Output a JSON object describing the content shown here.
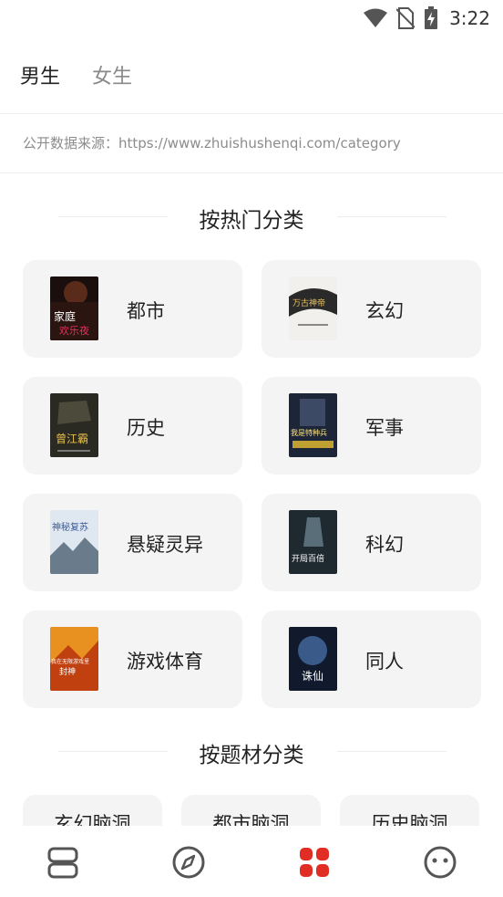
{
  "status_bar": {
    "time": "3:22"
  },
  "tabs": [
    {
      "label": "男生"
    },
    {
      "label": "女生"
    }
  ],
  "source_text": "公开数据来源：https://www.zhuishushenqi.com/category",
  "hot_section": {
    "title": "按热门分类",
    "categories": [
      {
        "label": "都市"
      },
      {
        "label": "玄幻"
      },
      {
        "label": "历史"
      },
      {
        "label": "军事"
      },
      {
        "label": "悬疑灵异"
      },
      {
        "label": "科幻"
      },
      {
        "label": "游戏体育"
      },
      {
        "label": "同人"
      }
    ]
  },
  "covers": [
    {
      "icon": "book-cover-urban",
      "text_line1": "家庭",
      "text_line2": "欢乐夜"
    },
    {
      "icon": "book-cover-fantasy",
      "text_line1": "万古神帝"
    },
    {
      "icon": "book-cover-history",
      "text_line1": "曾江霸"
    },
    {
      "icon": "book-cover-military",
      "text_line1": "我是特种兵"
    },
    {
      "icon": "book-cover-mystery",
      "text_line1": "神秘复苏"
    },
    {
      "icon": "book-cover-scifi",
      "text_line1": "开局百倍"
    },
    {
      "icon": "book-cover-game",
      "text_line1": "我在无限游戏里",
      "text_line2": "封神"
    },
    {
      "icon": "book-cover-fanfic",
      "text_line1": "诛仙"
    }
  ],
  "theme_section": {
    "title": "按题材分类",
    "tags": [
      {
        "label": "玄幻脑洞"
      },
      {
        "label": "都市脑洞"
      },
      {
        "label": "历史脑洞"
      }
    ]
  },
  "bottom_nav": [
    {
      "icon": "bookshelf-icon"
    },
    {
      "icon": "compass-icon"
    },
    {
      "icon": "category-grid-icon",
      "active_color": "#e02e24"
    },
    {
      "icon": "profile-face-icon"
    }
  ],
  "colors": {
    "accent": "#e02e24",
    "card_bg": "#f4f4f4"
  }
}
